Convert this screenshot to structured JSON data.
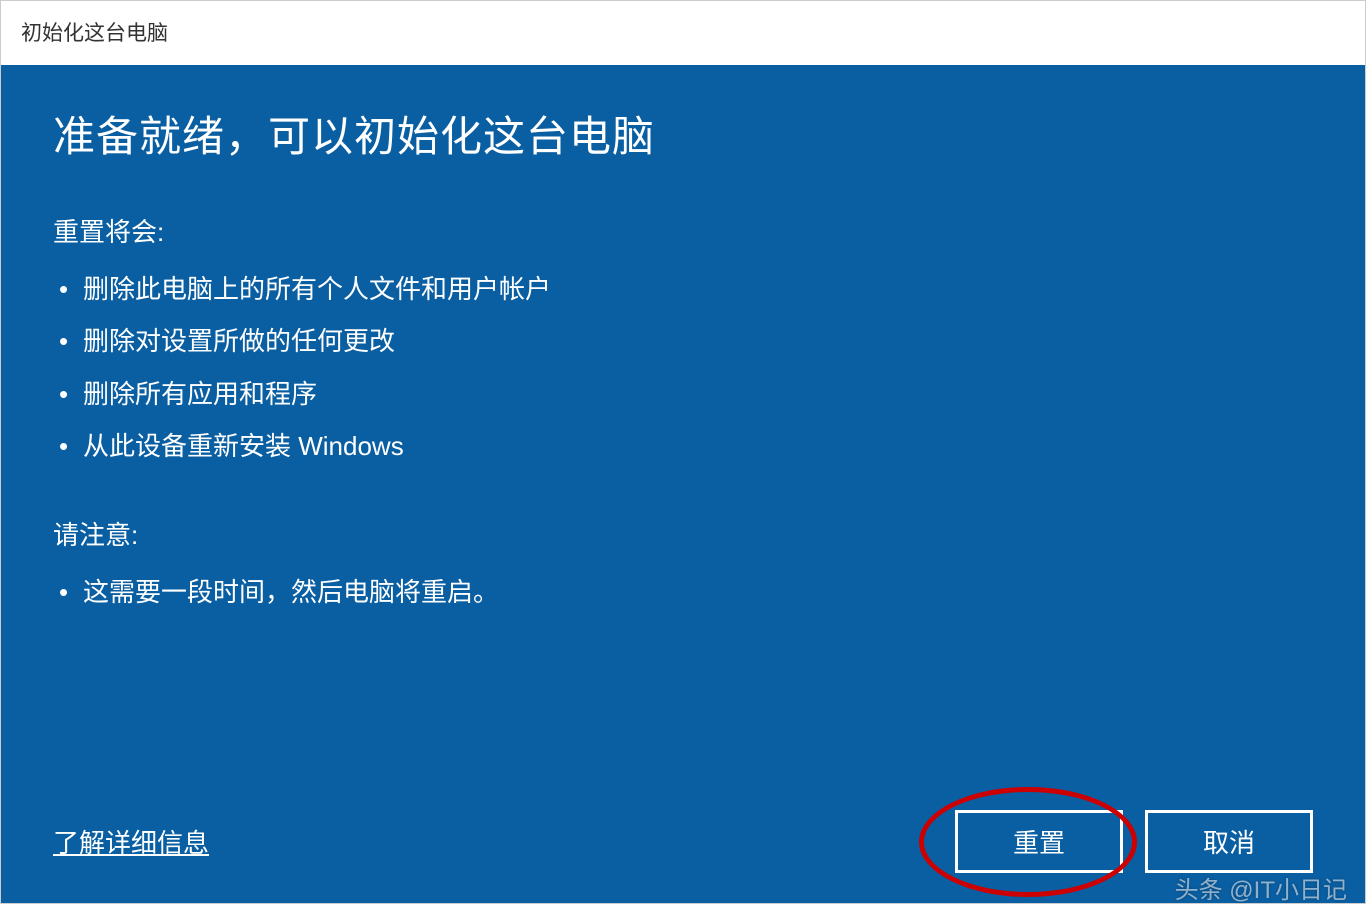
{
  "window": {
    "title": "初始化这台电脑"
  },
  "main": {
    "heading": "准备就绪，可以初始化这台电脑",
    "reset_label": "重置将会:",
    "reset_items": [
      "删除此电脑上的所有个人文件和用户帐户",
      "删除对设置所做的任何更改",
      "删除所有应用和程序",
      "从此设备重新安装 Windows"
    ],
    "note_label": "请注意:",
    "note_items": [
      "这需要一段时间，然后电脑将重启。"
    ]
  },
  "footer": {
    "learn_more": "了解详细信息",
    "reset_button": "重置",
    "cancel_button": "取消"
  },
  "watermark": "头条 @IT小日记"
}
